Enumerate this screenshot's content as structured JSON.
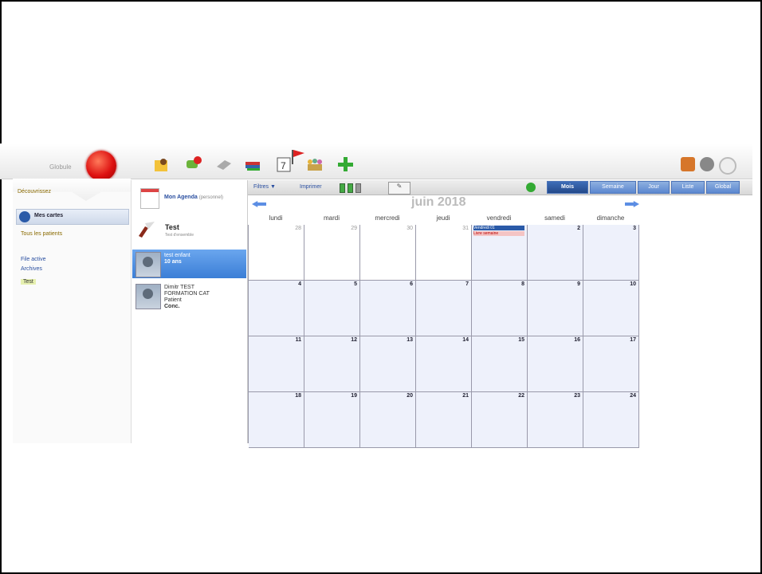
{
  "app": {
    "logo_text": "Globule",
    "toolbar_icons": [
      "folder-person-icon",
      "comment-add-icon",
      "eraser-icon",
      "books-icon",
      "calendar-day-icon",
      "flag-icon",
      "group-icon",
      "add-plus-icon"
    ],
    "right_icons": [
      "briefcase-icon",
      "circle-gray-icon",
      "settings-circle-icon"
    ]
  },
  "left": {
    "section_label": "Découvrissez",
    "mes_cartes": "Mes cartes",
    "tous_patients": "Tous les patients",
    "file_active": "File active",
    "archives": "Archives",
    "tag_test": "Test"
  },
  "list": {
    "agenda_title": "Mon Agenda",
    "agenda_sub": "(personnel)",
    "test_title": "Test",
    "test_sub": "Test d'ensemble",
    "patients": [
      {
        "line1": "test enfant",
        "line2": "10 ans",
        "selected": true
      },
      {
        "line1": "Dimitr TEST",
        "line2": "FORMATION CAT",
        "line3": "Patient",
        "line4": "Conc.",
        "selected": false
      }
    ]
  },
  "calendar": {
    "filtres": "Filtres ▼",
    "imprimer": "Imprimer",
    "month": "juin 2018",
    "views": [
      "Mois",
      "Semaine",
      "Jour",
      "Liste",
      "Global"
    ],
    "active_view": "Mois",
    "days": [
      "lundi",
      "mardi",
      "mercredi",
      "jeudi",
      "vendredi",
      "samedi",
      "dimanche"
    ],
    "weeks": [
      [
        "28",
        "29",
        "30",
        "31",
        "1",
        "2",
        "3"
      ],
      [
        "4",
        "5",
        "6",
        "7",
        "8",
        "9",
        "10"
      ],
      [
        "11",
        "12",
        "13",
        "14",
        "15",
        "16",
        "17"
      ],
      [
        "18",
        "19",
        "20",
        "21",
        "22",
        "23",
        "24"
      ]
    ],
    "events": {
      "blue": "Vendredi 01",
      "red": "Livre semaine"
    }
  }
}
